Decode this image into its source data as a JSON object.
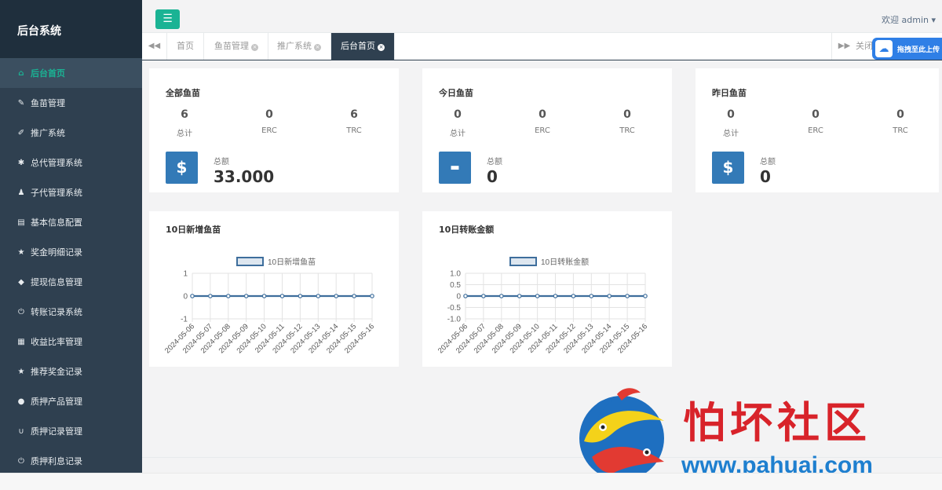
{
  "sidebar": {
    "title": "后台系统",
    "items": [
      {
        "label": "后台首页",
        "icon": "home-icon"
      },
      {
        "label": "鱼苗管理",
        "icon": "wrench-icon"
      },
      {
        "label": "推广系统",
        "icon": "edit-icon"
      },
      {
        "label": "总代管理系统",
        "icon": "asterisk-icon"
      },
      {
        "label": "子代管理系统",
        "icon": "users-icon"
      },
      {
        "label": "基本信息配置",
        "icon": "file-icon"
      },
      {
        "label": "奖金明细记录",
        "icon": "star-icon"
      },
      {
        "label": "提现信息管理",
        "icon": "tag-icon"
      },
      {
        "label": "转账记录系统",
        "icon": "power-icon"
      },
      {
        "label": "收益比率管理",
        "icon": "calendar-icon"
      },
      {
        "label": "推荐奖金记录",
        "icon": "star-icon"
      },
      {
        "label": "质押产品管理",
        "icon": "comment-icon"
      },
      {
        "label": "质押记录管理",
        "icon": "magnet-icon"
      },
      {
        "label": "质押利息记录",
        "icon": "power-icon"
      }
    ]
  },
  "header": {
    "welcome": "欢迎 admin ▾"
  },
  "tabs": [
    {
      "label": "首页",
      "closable": false
    },
    {
      "label": "鱼苗管理",
      "closable": true
    },
    {
      "label": "推广系统",
      "closable": true
    },
    {
      "label": "后台首页",
      "closable": true,
      "active": true
    }
  ],
  "tab_close_text": "关闭",
  "baidu_float": "拖拽至此上传",
  "panels": [
    {
      "title": "全部鱼苗",
      "stats": [
        {
          "value": "6",
          "label": "总计"
        },
        {
          "value": "0",
          "label": "ERC"
        },
        {
          "value": "6",
          "label": "TRC"
        }
      ],
      "total_label": "总额",
      "total_value": "33.000",
      "icon": "dollar-icon",
      "icon_glyph": "$"
    },
    {
      "title": "今日鱼苗",
      "stats": [
        {
          "value": "0",
          "label": "总计"
        },
        {
          "value": "0",
          "label": "ERC"
        },
        {
          "value": "0",
          "label": "TRC"
        }
      ],
      "total_label": "总额",
      "total_value": "0",
      "icon": "archive-icon",
      "icon_glyph": "▬"
    },
    {
      "title": "昨日鱼苗",
      "stats": [
        {
          "value": "0",
          "label": "总计"
        },
        {
          "value": "0",
          "label": "ERC"
        },
        {
          "value": "0",
          "label": "TRC"
        }
      ],
      "total_label": "总额",
      "total_value": "0",
      "icon": "dollar-icon",
      "icon_glyph": "$"
    }
  ],
  "chart_data": [
    {
      "type": "line",
      "title": "10日新增鱼苗",
      "categories": [
        "2024-05-06",
        "2024-05-07",
        "2024-05-08",
        "2024-05-09",
        "2024-05-10",
        "2024-05-11",
        "2024-05-12",
        "2024-05-13",
        "2024-05-14",
        "2024-05-15",
        "2024-05-16"
      ],
      "series": [
        {
          "name": "10日新增鱼苗",
          "values": [
            0,
            0,
            0,
            0,
            0,
            0,
            0,
            0,
            0,
            0,
            0
          ]
        }
      ],
      "yticks": [
        "1",
        "0",
        "-1"
      ],
      "ylim": [
        -1,
        1
      ],
      "grid": true,
      "legend": "top-center",
      "color": "#3e6e9c"
    },
    {
      "type": "line",
      "title": "10日转账金额",
      "categories": [
        "2024-05-06",
        "2024-05-07",
        "2024-05-08",
        "2024-05-09",
        "2024-05-10",
        "2024-05-11",
        "2024-05-12",
        "2024-05-13",
        "2024-05-14",
        "2024-05-15",
        "2024-05-16"
      ],
      "series": [
        {
          "name": "10日转账金额",
          "values": [
            0,
            0,
            0,
            0,
            0,
            0,
            0,
            0,
            0,
            0,
            0
          ]
        }
      ],
      "yticks": [
        "1.0",
        "0.5",
        "0",
        "-0.5",
        "-1.0"
      ],
      "ylim": [
        -1,
        1
      ],
      "grid": true,
      "legend": "top-center",
      "color": "#3e6e9c"
    }
  ],
  "watermark": {
    "title": "怕坏社区",
    "url": "www.pahuai.com"
  }
}
